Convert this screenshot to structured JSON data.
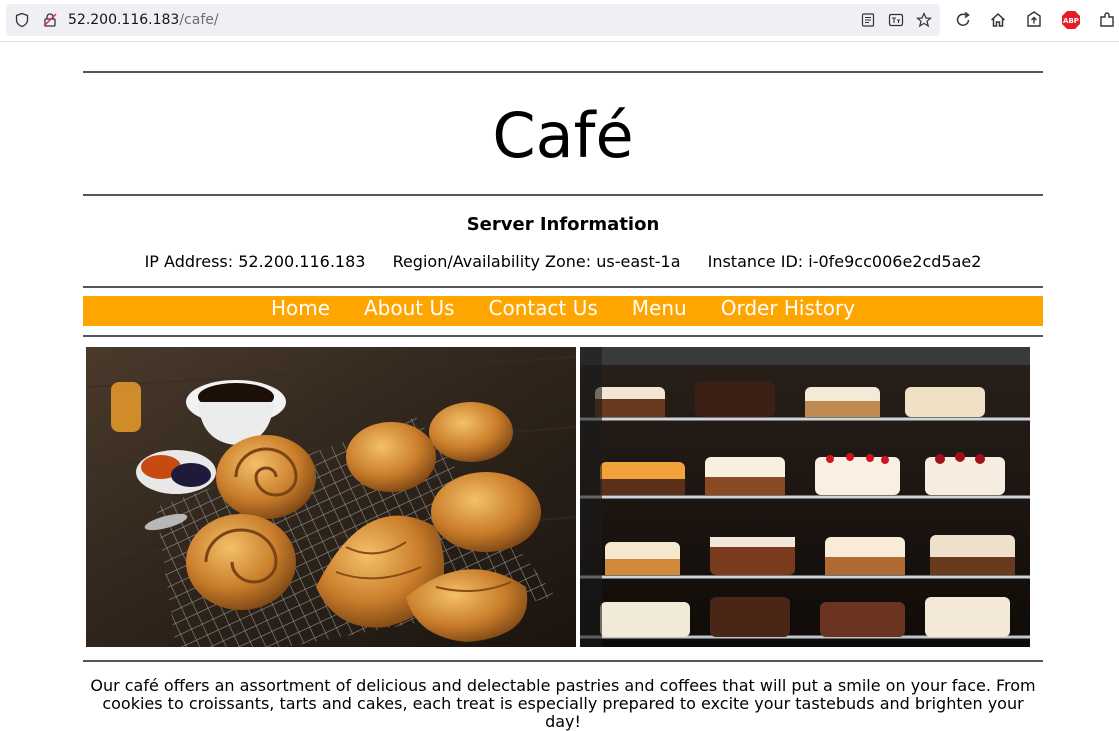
{
  "browser": {
    "url_host": "52.200.116.183",
    "url_path": "/cafe/",
    "icons": [
      "shield-icon",
      "insecure-lock-icon",
      "reader-view-icon",
      "translate-icon",
      "bookmark-star-icon",
      "reload-icon",
      "home-icon",
      "extension-icon",
      "adblock-icon",
      "extensions-menu-icon"
    ],
    "adblock_label": "ABP"
  },
  "page": {
    "title": "Café",
    "server_info": {
      "heading": "Server Information",
      "ip": "IP Address: 52.200.116.183",
      "region": "Region/Availability Zone: us-east-1a",
      "instance": "Instance ID: i-0fe9cc006e2cd5ae2"
    },
    "nav": [
      "Home",
      "About Us",
      "Contact Us",
      "Menu",
      "Order History"
    ],
    "nav_color": "#ffa500",
    "images": [
      "pastries-photo",
      "cake-display-photo"
    ],
    "description": "Our café offers an assortment of delicious and delectable pastries and coffees that will put a smile on your face. From cookies to croissants, tarts and cakes, each treat is especially prepared to excite your tastebuds and brighten your day!"
  }
}
